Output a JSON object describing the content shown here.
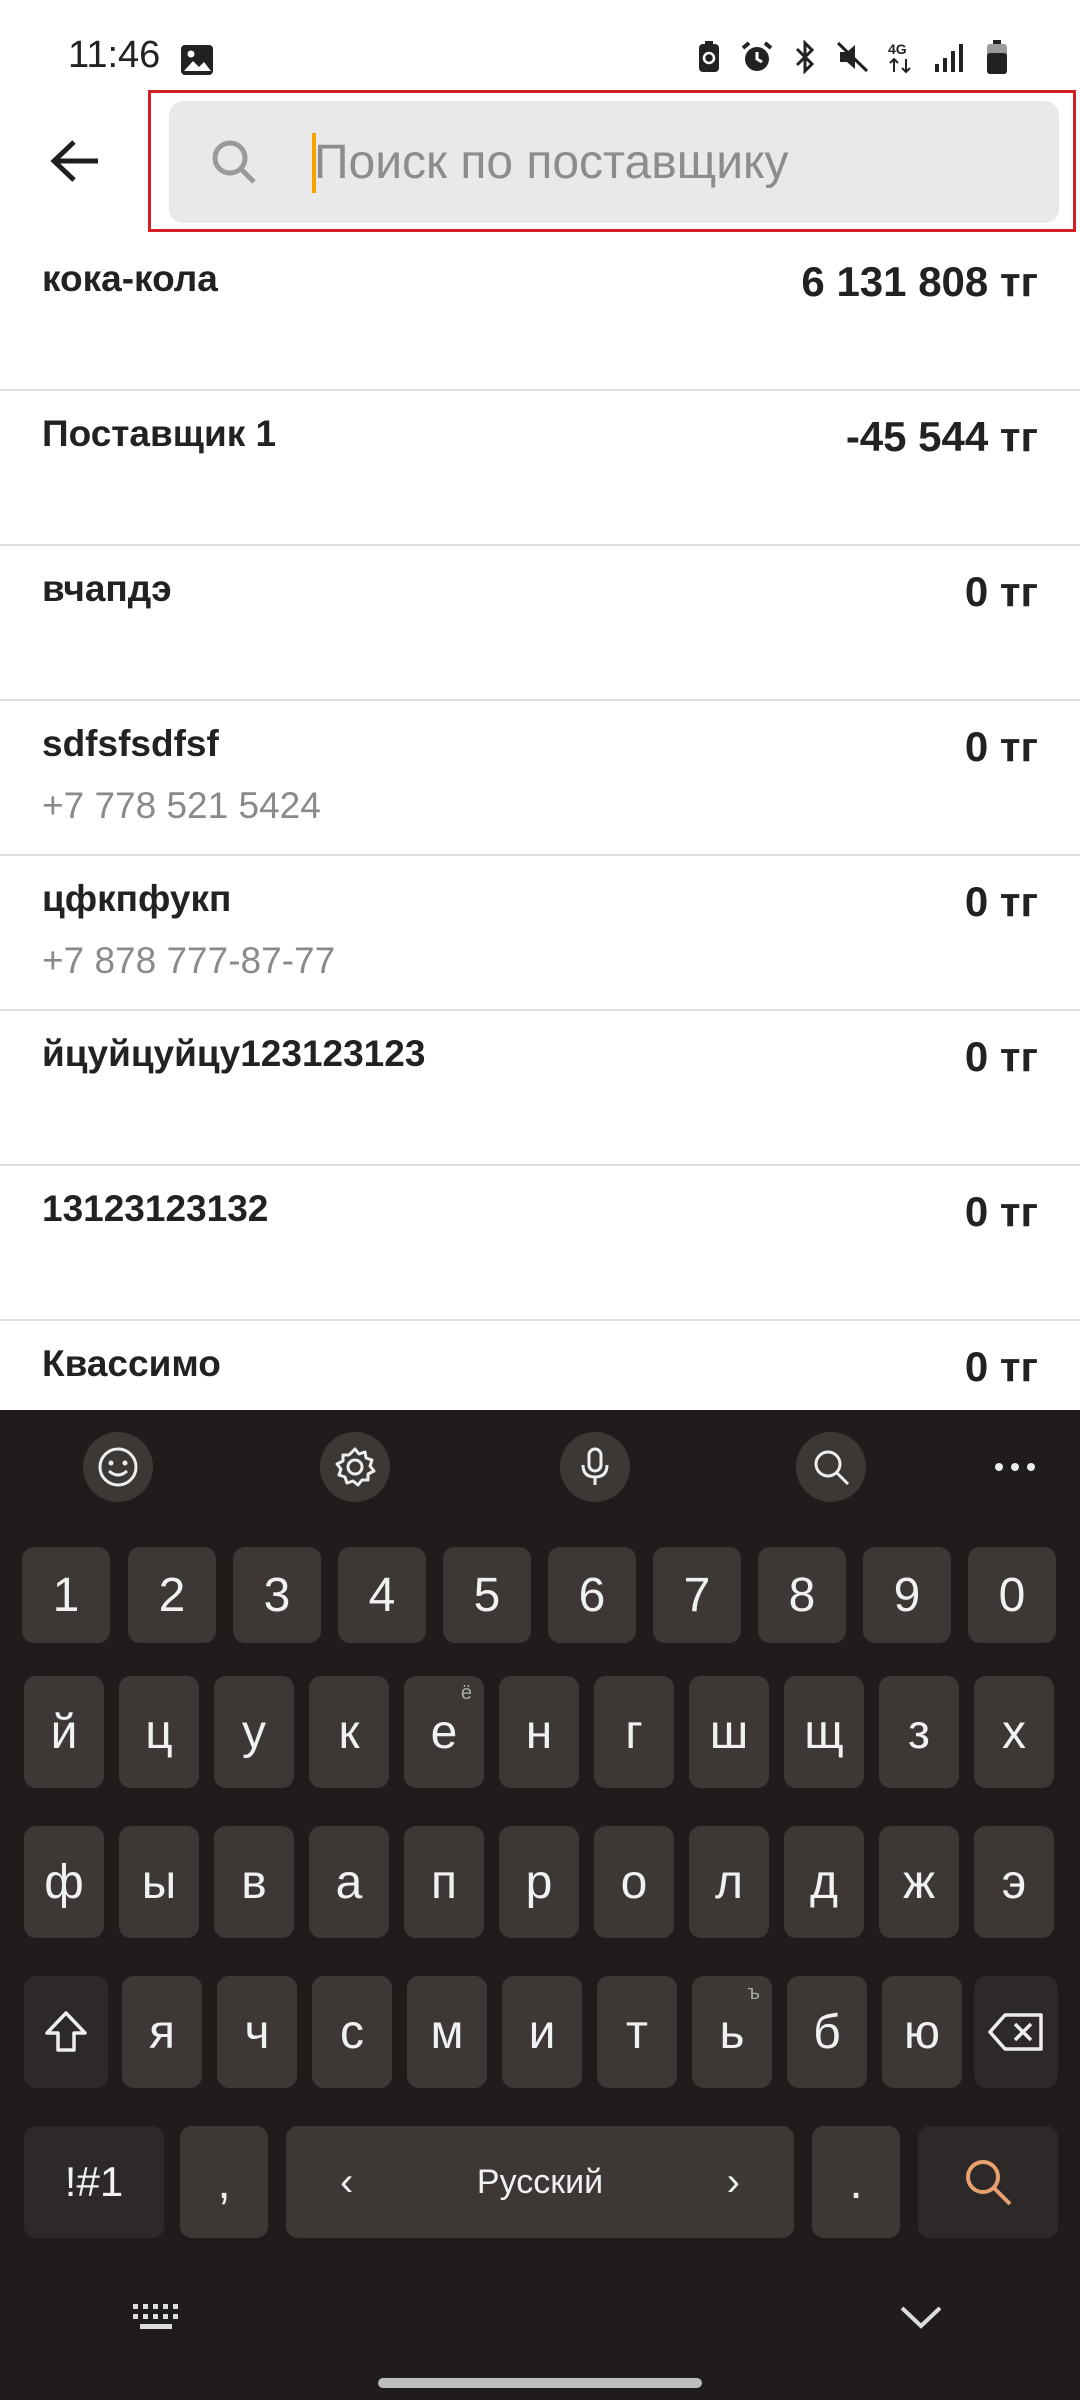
{
  "status_bar": {
    "time": "11:46",
    "icons": [
      "image-icon",
      "battery-saver-icon",
      "alarm-icon",
      "bluetooth-icon",
      "mute-icon",
      "4g-icon",
      "signal-icon",
      "battery-icon"
    ],
    "network_label": "4G"
  },
  "header": {
    "back_icon": "arrow-left-icon",
    "search": {
      "placeholder": "Поиск по поставщику",
      "value": ""
    },
    "highlight_color": "#d32027",
    "caret_color": "#f5a300"
  },
  "suppliers": [
    {
      "name": "кока-кола",
      "amount": "6 131 808 тг",
      "phone": ""
    },
    {
      "name": "Поставщик 1",
      "amount": "-45 544 тг",
      "phone": ""
    },
    {
      "name": "вчапдэ",
      "amount": "0 тг",
      "phone": ""
    },
    {
      "name": "sdfsfsdfsf",
      "amount": "0 тг",
      "phone": "+7 778 521 5424"
    },
    {
      "name": "цфкпфукп",
      "amount": "0 тг",
      "phone": "+7 878 777-87-77"
    },
    {
      "name": "йцуйцуйцу123123123",
      "amount": "0 тг",
      "phone": ""
    },
    {
      "name": "13123123132",
      "amount": "0 тг",
      "phone": ""
    },
    {
      "name": "Квассимо",
      "amount": "0 тг",
      "phone": ""
    }
  ],
  "keyboard": {
    "toolbar": [
      "emoji-icon",
      "settings-icon",
      "microphone-icon",
      "search-icon",
      "more-icon"
    ],
    "numbers": [
      "1",
      "2",
      "3",
      "4",
      "5",
      "6",
      "7",
      "8",
      "9",
      "0"
    ],
    "row1": [
      "й",
      "ц",
      "у",
      "к",
      "е",
      "н",
      "г",
      "ш",
      "щ",
      "з",
      "х"
    ],
    "row1_hint_e": "ё",
    "row2": [
      "ф",
      "ы",
      "в",
      "а",
      "п",
      "р",
      "о",
      "л",
      "д",
      "ж",
      "э"
    ],
    "row3": [
      "я",
      "ч",
      "с",
      "м",
      "и",
      "т",
      "ь",
      "б",
      "ю"
    ],
    "row3_hint_soft": "ъ",
    "symbols_label": "!#1",
    "comma_label": ",",
    "language_label": "Русский",
    "lang_prev": "‹",
    "lang_next": "›",
    "period_label": ".",
    "action_color": "#e8a06e",
    "nav": [
      "keyboard-icon",
      "hide-keyboard-icon"
    ]
  }
}
